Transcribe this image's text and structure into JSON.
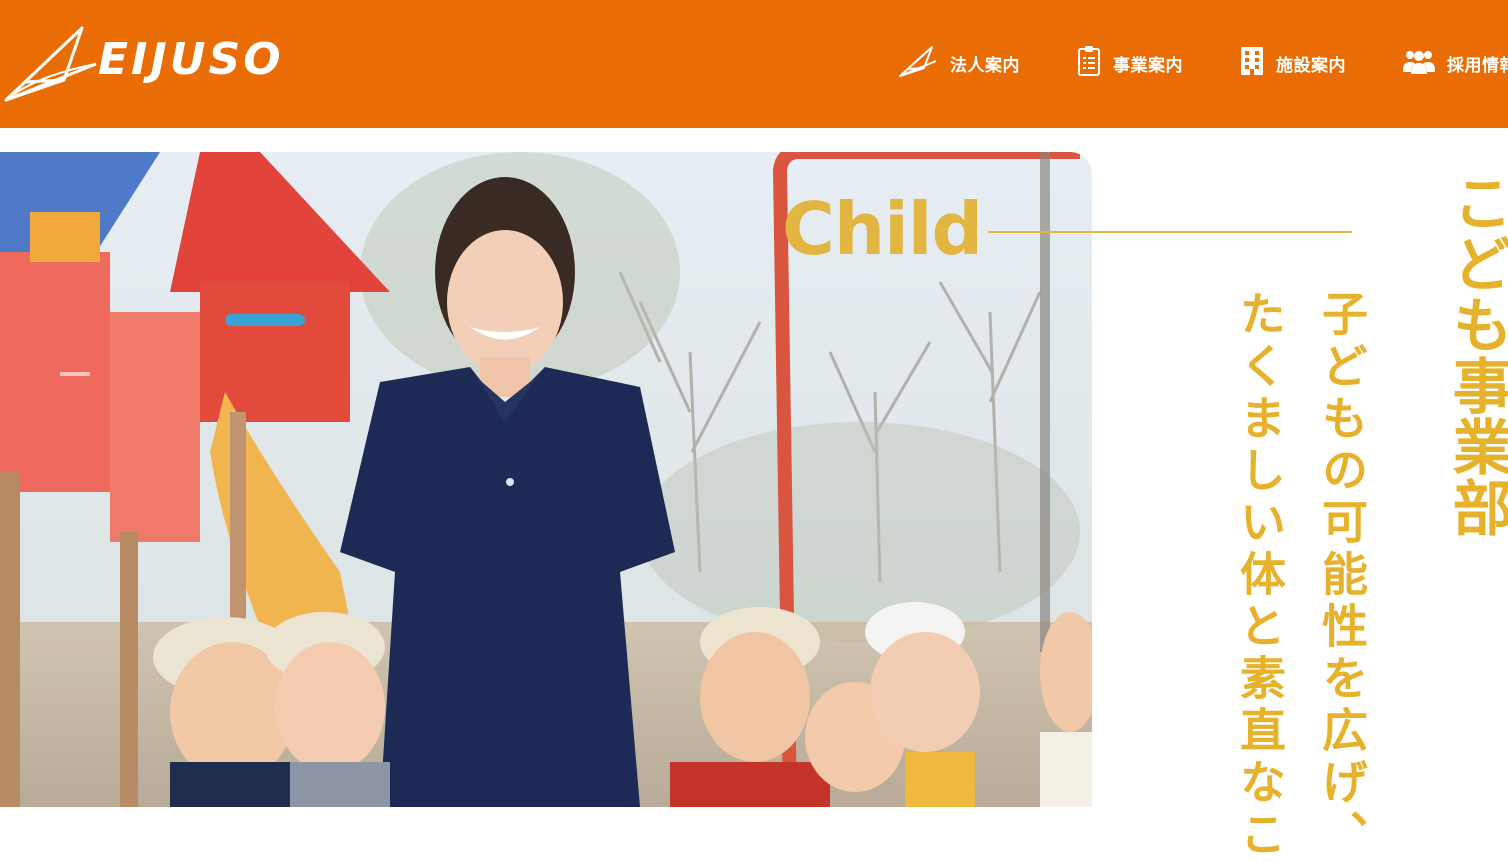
{
  "header": {
    "logo_text": "EIJUSO",
    "bg_color": "#e96d04",
    "nav": [
      {
        "label": "法人案内",
        "icon": "paper-plane-icon"
      },
      {
        "label": "事業案内",
        "icon": "clipboard-list-icon"
      },
      {
        "label": "施設案内",
        "icon": "building-icon"
      },
      {
        "label": "採用情報",
        "icon": "users-icon"
      }
    ]
  },
  "section": {
    "english_label": "Child",
    "title": "こども事業部",
    "copy_lines": [
      "子どもの可能性を広げ、",
      "たくましい体と素直なこ"
    ],
    "accent_color": "#e6b22b"
  },
  "hero": {
    "image_description": "A smiling female caregiver in a navy polo shirt standing in a playground with a group of smiling young children wearing hats"
  }
}
